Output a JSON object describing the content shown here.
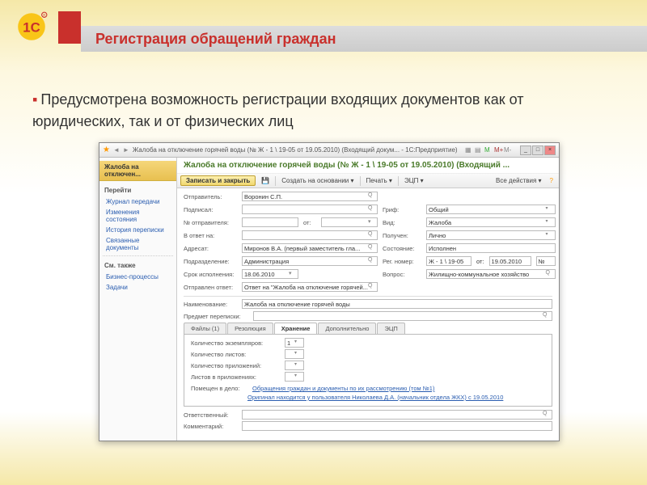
{
  "slide": {
    "title": "Регистрация обращений граждан",
    "body": "Предусмотрена возможность регистрации входящих документов как от юридических, так и от физических лиц"
  },
  "app": {
    "window_title": "Жалоба на отключение горячей воды (№ Ж - 1 \\ 19-05 от 19.05.2010) (Входящий докум... - 1С:Предприятие)",
    "main_title": "Жалоба на отключение горячей воды (№ Ж - 1 \\ 19-05 от 19.05.2010) (Входящий ...",
    "sidebar": {
      "head": "Жалоба на отключен...",
      "grp1": "Перейти",
      "items1": [
        "Журнал передачи",
        "Изменения состояния",
        "История переписки",
        "Связанные документы"
      ],
      "grp2": "См. также",
      "items2": [
        "Бизнес-процессы",
        "Задачи"
      ]
    },
    "toolbar": {
      "save": "Записать и закрыть",
      "create": "Создать на основании ▾",
      "print": "Печать ▾",
      "ecp": "ЭЦП ▾",
      "all": "Все действия ▾"
    },
    "fields": {
      "otpravitel_l": "Отправитель:",
      "otpravitel": "Воронин С.П.",
      "podpisal_l": "Подписал:",
      "nomer_otpr_l": "№ отправителя:",
      "ot_l": "от:",
      "v_otvet_l": "В ответ на:",
      "adresat_l": "Адресат:",
      "adresat": "Миронов В.А. (первый заместитель гла...",
      "podrazd_l": "Подразделение:",
      "podrazd": "Администрация",
      "srok_l": "Срок исполнения:",
      "srok": "18.06.2010",
      "otpr_otv_l": "Отправлен ответ:",
      "otpr_otv": "Ответ на \"Жалоба на отключение горячей...",
      "grif_l": "Гриф:",
      "grif": "Общий",
      "vid_l": "Вид:",
      "vid": "Жалоба",
      "poluchen_l": "Получен:",
      "poluchen": "Лично",
      "sost_l": "Состояние:",
      "sost": "Исполнен",
      "regnom_l": "Рег. номер:",
      "regnom": "Ж - 1 \\ 19-05",
      "regnom_ot_l": "от:",
      "regnom_ot": "19.05.2010",
      "vopros_l": "Вопрос:",
      "vopros": "Жилищно-коммунальное хозяйство",
      "naim_l": "Наименование:",
      "naim": "Жалоба на отключение горячей воды",
      "predmet_l": "Предмет переписки:",
      "otvetst_l": "Ответственный:",
      "komment_l": "Комментарий:"
    },
    "tabs": {
      "t1": "Файлы (1)",
      "t2": "Резолюция",
      "t3": "Хранение",
      "t4": "Дополнительно",
      "t5": "ЭЦП",
      "kol_ekz_l": "Количество экземпляров:",
      "kol_ekz": "1",
      "kol_list_l": "Количество листов:",
      "kol_pril_l": "Количество приложений:",
      "list_pril_l": "Листов в приложениях:",
      "pom_delo_l": "Помещен в дело:",
      "pom_delo": "Обращения граждан и документы по их рассмотрению (том №1)",
      "orig": "Оригинал находится у пользователя Николаева Д.А. (начальник отдела ЖКХ) с 19.05.2010"
    }
  }
}
